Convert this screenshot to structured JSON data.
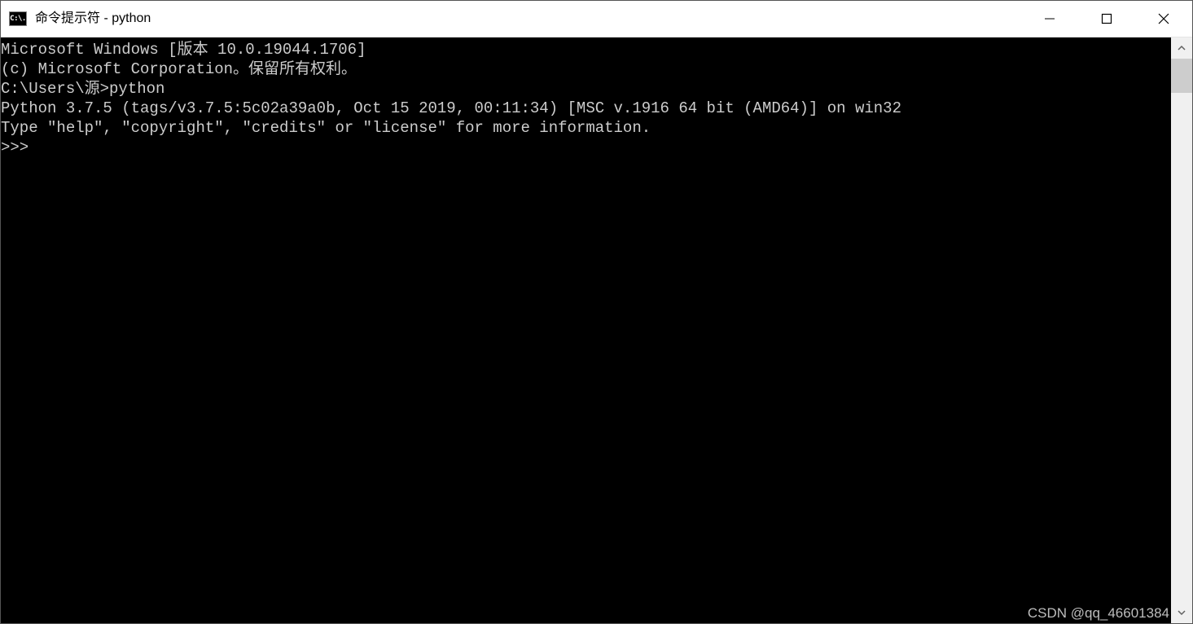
{
  "titlebar": {
    "icon_label": "C:\\.",
    "title": "命令提示符 - python"
  },
  "console": {
    "lines": [
      "Microsoft Windows [版本 10.0.19044.1706]",
      "(c) Microsoft Corporation。保留所有权利。",
      "",
      "C:\\Users\\源>python",
      "Python 3.7.5 (tags/v3.7.5:5c02a39a0b, Oct 15 2019, 00:11:34) [MSC v.1916 64 bit (AMD64)] on win32",
      "Type \"help\", \"copyright\", \"credits\" or \"license\" for more information.",
      ">>>"
    ]
  },
  "watermark": "CSDN @qq_46601384"
}
